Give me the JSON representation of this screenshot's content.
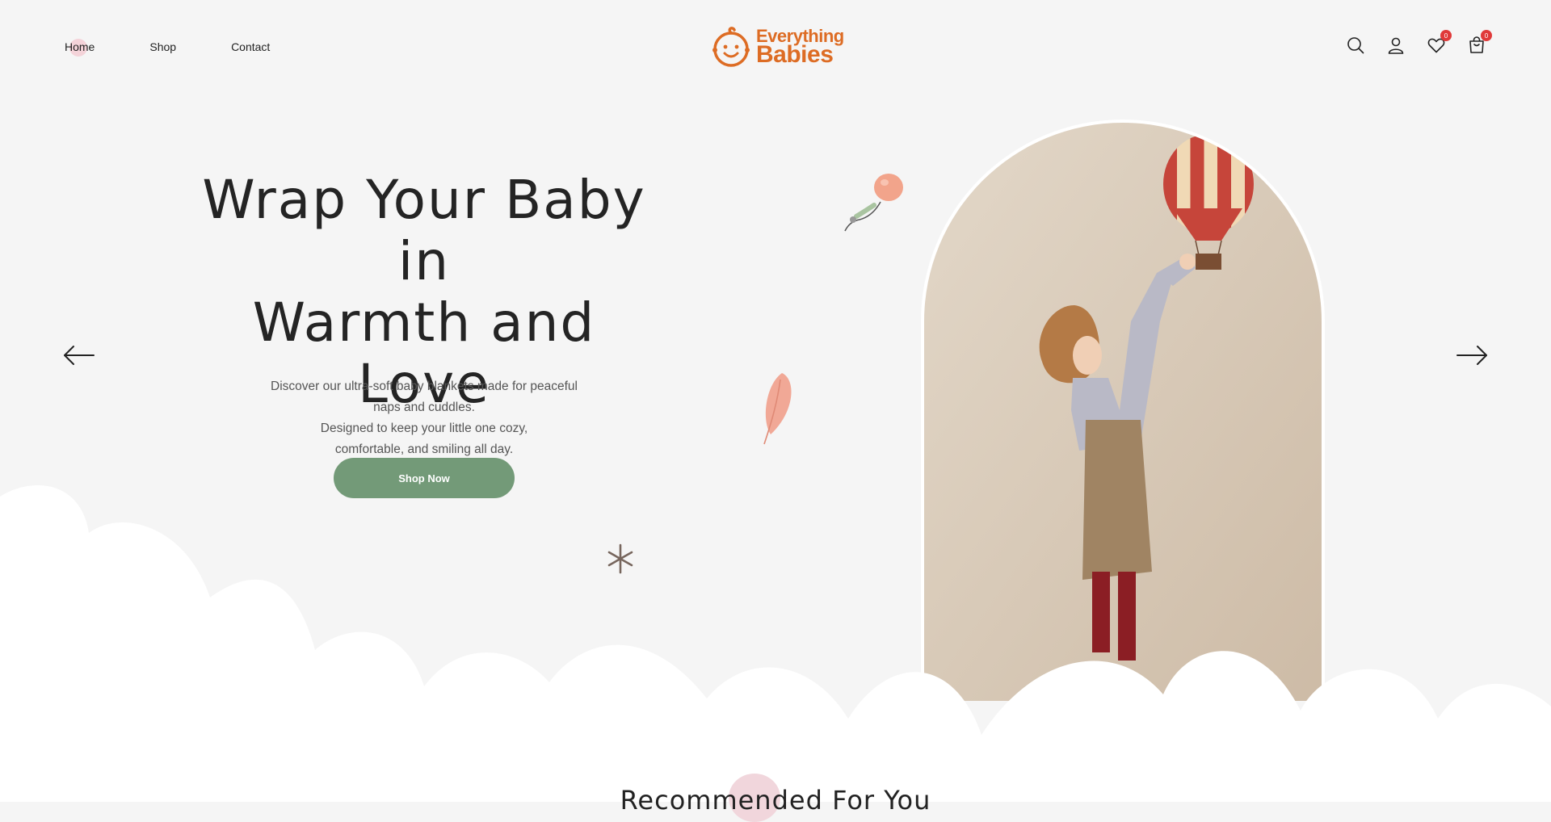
{
  "nav": {
    "links": [
      {
        "label": "Home",
        "active": true
      },
      {
        "label": "Shop",
        "active": false
      },
      {
        "label": "Contact",
        "active": false
      }
    ],
    "logo": {
      "line1": "Everything",
      "line2": "Babies",
      "color": "#dd6c24"
    },
    "icons": [
      "search-icon",
      "user-icon",
      "heart-icon",
      "cart-icon"
    ],
    "wishlist_count": "0",
    "cart_count": "0"
  },
  "hero": {
    "title_lines": [
      "Wrap Your Baby",
      "in",
      "Warmth and Love"
    ],
    "description_lines": [
      "Discover our ultra-soft baby blankets made for peaceful",
      "naps and cuddles.",
      "Designed to keep your little one cozy,",
      "comfortable, and smiling all day."
    ],
    "cta_label": "Shop Now",
    "cta_color": "#739a78",
    "prev_icon": "arrow-left-icon",
    "next_icon": "arrow-right-icon"
  },
  "recommended": {
    "title": "Recommended For You"
  },
  "colors": {
    "background": "#f5f5f5",
    "badge": "#e03a3a",
    "accent_pink": "#f3c7cf"
  }
}
